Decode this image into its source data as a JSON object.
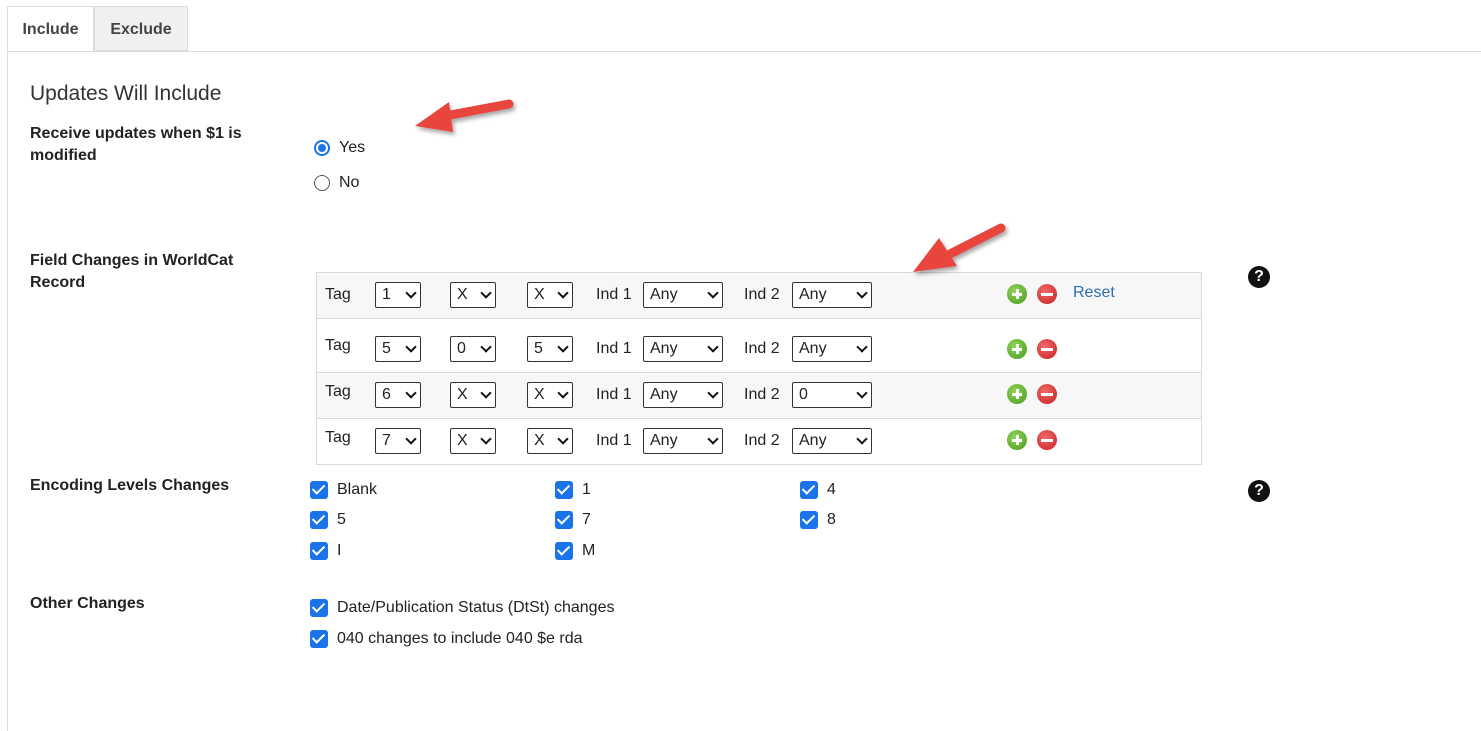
{
  "tabs": [
    {
      "label": "Include",
      "active": true
    },
    {
      "label": "Exclude",
      "active": false
    }
  ],
  "heading": "Updates Will Include",
  "dollar1": {
    "label": "Receive updates when $1 is modified",
    "options": [
      {
        "label": "Yes",
        "checked": true
      },
      {
        "label": "No",
        "checked": false
      }
    ]
  },
  "field_changes": {
    "label": "Field Changes in WorldCat Record",
    "tag_label": "Tag",
    "ind1_label": "Ind 1",
    "ind2_label": "Ind 2",
    "reset_label": "Reset",
    "rows": [
      {
        "tag1": "1",
        "tag2": "X",
        "tag3": "X",
        "ind1": "Any",
        "ind2": "Any"
      },
      {
        "tag1": "5",
        "tag2": "0",
        "tag3": "5",
        "ind1": "Any",
        "ind2": "Any"
      },
      {
        "tag1": "6",
        "tag2": "X",
        "tag3": "X",
        "ind1": "Any",
        "ind2": "0"
      },
      {
        "tag1": "7",
        "tag2": "X",
        "tag3": "X",
        "ind1": "Any",
        "ind2": "Any"
      }
    ]
  },
  "encoding": {
    "label": "Encoding Levels Changes",
    "options": [
      {
        "label": "Blank",
        "checked": true
      },
      {
        "label": "1",
        "checked": true
      },
      {
        "label": "4",
        "checked": true
      },
      {
        "label": "5",
        "checked": true
      },
      {
        "label": "7",
        "checked": true
      },
      {
        "label": "8",
        "checked": true
      },
      {
        "label": "I",
        "checked": true
      },
      {
        "label": "M",
        "checked": true
      }
    ]
  },
  "other": {
    "label": "Other Changes",
    "options": [
      {
        "label": "Date/Publication Status (DtSt) changes",
        "checked": true
      },
      {
        "label": "040 changes to include 040 $e rda",
        "checked": true
      }
    ]
  },
  "help_glyph": "?",
  "colors": {
    "accent": "#1a73e8",
    "link": "#2f6fb1",
    "annotation_arrow": "#e8453c",
    "add_button": "#4a9a1e",
    "remove_button": "#c91f1f"
  }
}
